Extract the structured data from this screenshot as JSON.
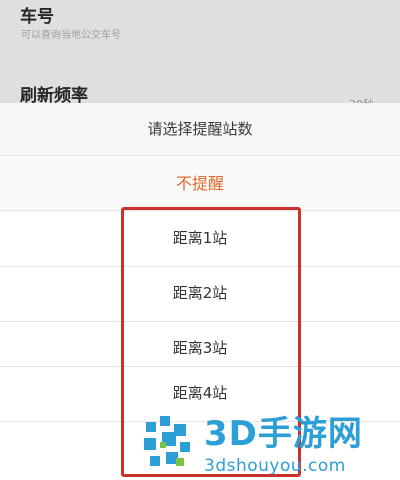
{
  "background": {
    "item_bus": {
      "title": "车号",
      "subtitle": "可以查询当地公交车号"
    },
    "item_refresh": {
      "title": "刷新频率",
      "value": "30秒"
    }
  },
  "sheet": {
    "title": "请选择提醒站数",
    "option_none": "不提醒",
    "options": [
      "距离1站",
      "距离2站",
      "距离3站",
      "距离4站"
    ]
  },
  "watermark": {
    "text": "3D手游网",
    "url": "3dshouyou.com"
  },
  "colors": {
    "accent": "#e06a2b",
    "highlight": "#c8322b",
    "watermark": "#2c9fd6"
  }
}
